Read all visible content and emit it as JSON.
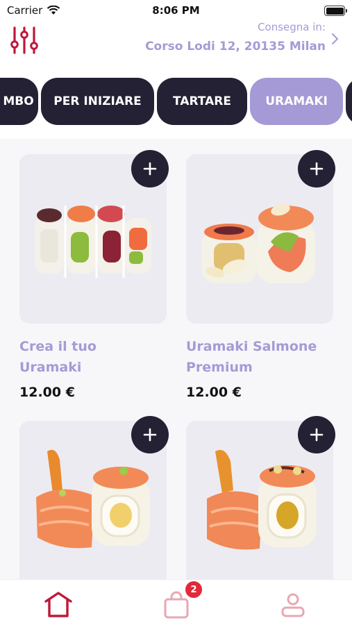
{
  "status_bar": {
    "carrier": "Carrier",
    "time": "8:06 PM"
  },
  "header": {
    "delivery_label": "Consegna in:",
    "delivery_address": "Corso Lodi 12, 20135 Milan"
  },
  "categories": [
    {
      "label": "MBO",
      "active": false
    },
    {
      "label": "PER INIZIARE",
      "active": false
    },
    {
      "label": "TARTARE",
      "active": false
    },
    {
      "label": "URAMAKI",
      "active": true
    }
  ],
  "products": [
    {
      "name_line1": "Crea il tuo",
      "name_line2": "Uramaki",
      "price": "12.00 €"
    },
    {
      "name_line1": "Uramaki Salmone",
      "name_line2": "Premium",
      "price": "12.00 €"
    },
    {
      "name_line1": "",
      "name_line2": "",
      "price": ""
    },
    {
      "name_line1": "",
      "name_line2": "",
      "price": ""
    }
  ],
  "cart": {
    "badge_count": "2"
  },
  "colors": {
    "accent": "#a59ad6",
    "dark": "#242134",
    "brand_red": "#c0173a",
    "badge": "#e2283a"
  },
  "icons": [
    "filter-sliders-icon",
    "chevron-right-icon",
    "plus-icon",
    "home-icon",
    "shopping-bag-icon",
    "user-icon"
  ]
}
